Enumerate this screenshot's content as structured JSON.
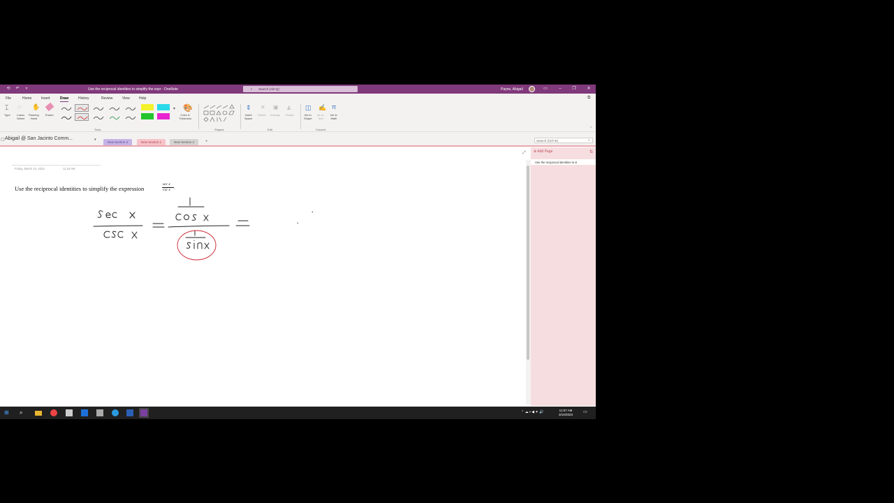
{
  "window": {
    "title": "Use the reciprocal identities to simplify the expr - OneNote",
    "search_placeholder": "Search (Alt+Q)",
    "user": "Payne, Abigail"
  },
  "ribbon_tabs": [
    "File",
    "Home",
    "Insert",
    "Draw",
    "History",
    "Review",
    "View",
    "Help"
  ],
  "active_tab": "Draw",
  "ribbon": {
    "tools": {
      "type": "Type",
      "lasso": "Lasso\nSelect",
      "panning": "Panning\nHand",
      "eraser": "Eraser"
    },
    "color_thickness": "Color &\nThickness",
    "insert_space": "Insert\nSpace",
    "delete": "Delete",
    "arrange": "Arrange",
    "rotate": "Rotate",
    "ink_to_shape": "Ink to\nShape",
    "ink_to_text": "Ink to\nText",
    "ink_to_math": "Ink to\nMath",
    "groups": {
      "tools": "Tools",
      "shapes": "Shapes",
      "edit": "Edit",
      "convert": "Convert"
    }
  },
  "notebook": {
    "name": "Abigail @ San Jacinto Comm...",
    "sections": [
      {
        "label": "New Section 3",
        "color": "#c5b3e6"
      },
      {
        "label": "New Section 1",
        "color": "#f6c3c8"
      },
      {
        "label": "New Section 2",
        "color": "#d4d4d4"
      }
    ],
    "add_section": "+",
    "search_placeholder": "Search (Ctrl+E)"
  },
  "page": {
    "date": "Friday, March 10, 2023",
    "time": "11:33 AM",
    "question": "Use the reciprocal identities to simplify the expression",
    "fraction_num": "sec x",
    "fraction_den": "csc x"
  },
  "page_list": {
    "add_page": "Add Page",
    "items": [
      "Use the reciprocal identities to si"
    ]
  },
  "taskbar": {
    "time": "11:57 AM",
    "date": "3/10/2023"
  },
  "colors": {
    "titlebar": "#80397b",
    "accent_pink": "#e9a8ae",
    "ink": "#222222",
    "ink_red": "#d0303a"
  }
}
